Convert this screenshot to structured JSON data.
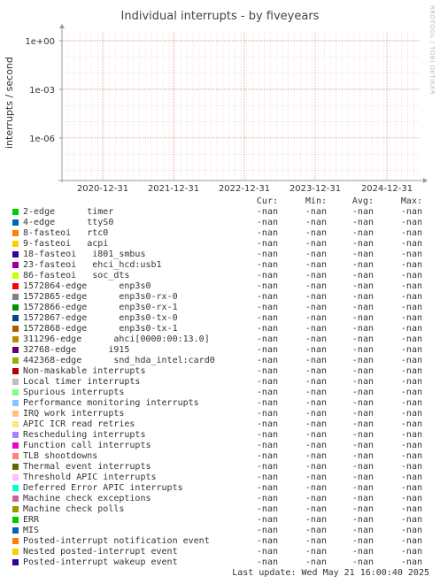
{
  "header": {
    "title": "Individual interrupts - by fiveyears",
    "watermark": "RRDTOOL / TOBI OETIKER"
  },
  "chart_data": {
    "type": "line",
    "ylabel": "interrupts / second",
    "yscale": "log",
    "y_ticks": [
      "1e+00",
      "1e-03",
      "1e-06"
    ],
    "x_ticks": [
      "2020-12-31",
      "2021-12-31",
      "2022-12-31",
      "2023-12-31",
      "2024-12-31"
    ],
    "grid": true,
    "series_values_note": "-nan",
    "series": []
  },
  "legend": {
    "headers": [
      "Cur:",
      "Min:",
      "Avg:",
      "Max:"
    ],
    "items": [
      {
        "name": "2-edge      timer",
        "color": "#00cc00",
        "cur": "-nan",
        "min": "-nan",
        "avg": "-nan",
        "max": "-nan"
      },
      {
        "name": "4-edge      ttyS0",
        "color": "#0066b3",
        "cur": "-nan",
        "min": "-nan",
        "avg": "-nan",
        "max": "-nan"
      },
      {
        "name": "8-fasteoi   rtc0",
        "color": "#ff8000",
        "cur": "-nan",
        "min": "-nan",
        "avg": "-nan",
        "max": "-nan"
      },
      {
        "name": "9-fasteoi   acpi",
        "color": "#ffcc00",
        "cur": "-nan",
        "min": "-nan",
        "avg": "-nan",
        "max": "-nan"
      },
      {
        "name": "18-fasteoi   i801_smbus",
        "color": "#330099",
        "cur": "-nan",
        "min": "-nan",
        "avg": "-nan",
        "max": "-nan"
      },
      {
        "name": "23-fasteoi   ehci_hcd:usb1",
        "color": "#990099",
        "cur": "-nan",
        "min": "-nan",
        "avg": "-nan",
        "max": "-nan"
      },
      {
        "name": "86-fasteoi   soc_dts",
        "color": "#ccff00",
        "cur": "-nan",
        "min": "-nan",
        "avg": "-nan",
        "max": "-nan"
      },
      {
        "name": "1572864-edge      enp3s0",
        "color": "#ff0000",
        "cur": "-nan",
        "min": "-nan",
        "avg": "-nan",
        "max": "-nan"
      },
      {
        "name": "1572865-edge      enp3s0-rx-0",
        "color": "#808080",
        "cur": "-nan",
        "min": "-nan",
        "avg": "-nan",
        "max": "-nan"
      },
      {
        "name": "1572866-edge      enp3s0-rx-1",
        "color": "#008f00",
        "cur": "-nan",
        "min": "-nan",
        "avg": "-nan",
        "max": "-nan"
      },
      {
        "name": "1572867-edge      enp3s0-tx-0",
        "color": "#00487d",
        "cur": "-nan",
        "min": "-nan",
        "avg": "-nan",
        "max": "-nan"
      },
      {
        "name": "1572868-edge      enp3s0-tx-1",
        "color": "#b35a00",
        "cur": "-nan",
        "min": "-nan",
        "avg": "-nan",
        "max": "-nan"
      },
      {
        "name": "311296-edge      ahci[0000:00:13.0]",
        "color": "#b38f00",
        "cur": "-nan",
        "min": "-nan",
        "avg": "-nan",
        "max": "-nan"
      },
      {
        "name": "32768-edge      i915",
        "color": "#6b006b",
        "cur": "-nan",
        "min": "-nan",
        "avg": "-nan",
        "max": "-nan"
      },
      {
        "name": "442368-edge      snd_hda_intel:card0",
        "color": "#8fb300",
        "cur": "-nan",
        "min": "-nan",
        "avg": "-nan",
        "max": "-nan"
      },
      {
        "name": "Non-maskable interrupts",
        "color": "#b30000",
        "cur": "-nan",
        "min": "-nan",
        "avg": "-nan",
        "max": "-nan"
      },
      {
        "name": "Local timer interrupts",
        "color": "#bebebe",
        "cur": "-nan",
        "min": "-nan",
        "avg": "-nan",
        "max": "-nan"
      },
      {
        "name": "Spurious interrupts",
        "color": "#80ff80",
        "cur": "-nan",
        "min": "-nan",
        "avg": "-nan",
        "max": "-nan"
      },
      {
        "name": "Performance monitoring interrupts",
        "color": "#80c9ff",
        "cur": "-nan",
        "min": "-nan",
        "avg": "-nan",
        "max": "-nan"
      },
      {
        "name": "IRQ work interrupts",
        "color": "#ffc080",
        "cur": "-nan",
        "min": "-nan",
        "avg": "-nan",
        "max": "-nan"
      },
      {
        "name": "APIC ICR read retries",
        "color": "#ffe680",
        "cur": "-nan",
        "min": "-nan",
        "avg": "-nan",
        "max": "-nan"
      },
      {
        "name": "Rescheduling interrupts",
        "color": "#aa80ff",
        "cur": "-nan",
        "min": "-nan",
        "avg": "-nan",
        "max": "-nan"
      },
      {
        "name": "Function call interrupts",
        "color": "#ee00cc",
        "cur": "-nan",
        "min": "-nan",
        "avg": "-nan",
        "max": "-nan"
      },
      {
        "name": "TLB shootdowns",
        "color": "#ff8080",
        "cur": "-nan",
        "min": "-nan",
        "avg": "-nan",
        "max": "-nan"
      },
      {
        "name": "Thermal event interrupts",
        "color": "#666600",
        "cur": "-nan",
        "min": "-nan",
        "avg": "-nan",
        "max": "-nan"
      },
      {
        "name": "Threshold APIC interrupts",
        "color": "#ffbfff",
        "cur": "-nan",
        "min": "-nan",
        "avg": "-nan",
        "max": "-nan"
      },
      {
        "name": "Deferred Error APIC interrupts",
        "color": "#00ffcc",
        "cur": "-nan",
        "min": "-nan",
        "avg": "-nan",
        "max": "-nan"
      },
      {
        "name": "Machine check exceptions",
        "color": "#cc6699",
        "cur": "-nan",
        "min": "-nan",
        "avg": "-nan",
        "max": "-nan"
      },
      {
        "name": "Machine check polls",
        "color": "#999900",
        "cur": "-nan",
        "min": "-nan",
        "avg": "-nan",
        "max": "-nan"
      },
      {
        "name": "ERR",
        "color": "#00cc00",
        "cur": "-nan",
        "min": "-nan",
        "avg": "-nan",
        "max": "-nan"
      },
      {
        "name": "MIS",
        "color": "#0066b3",
        "cur": "-nan",
        "min": "-nan",
        "avg": "-nan",
        "max": "-nan"
      },
      {
        "name": "Posted-interrupt notification event",
        "color": "#ff8000",
        "cur": "-nan",
        "min": "-nan",
        "avg": "-nan",
        "max": "-nan"
      },
      {
        "name": "Nested posted-interrupt event",
        "color": "#ffcc00",
        "cur": "-nan",
        "min": "-nan",
        "avg": "-nan",
        "max": "-nan"
      },
      {
        "name": "Posted-interrupt wakeup event",
        "color": "#330099",
        "cur": "-nan",
        "min": "-nan",
        "avg": "-nan",
        "max": "-nan"
      }
    ]
  },
  "footer": {
    "last_update": "Last update: Wed May 21 16:00:40 2025"
  }
}
